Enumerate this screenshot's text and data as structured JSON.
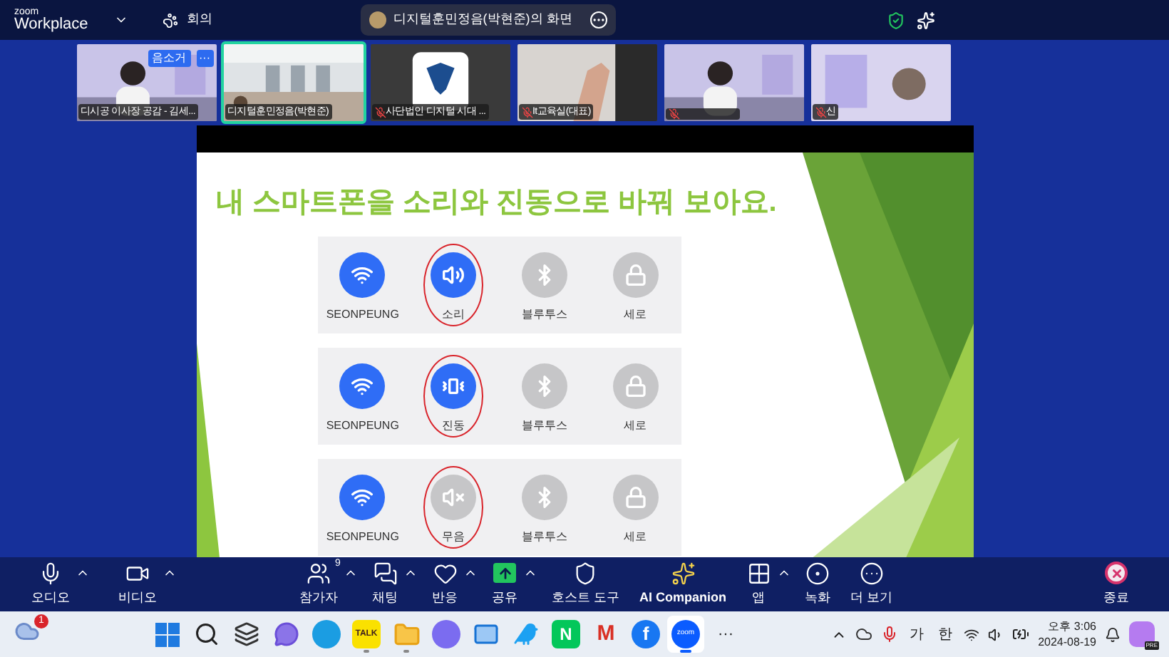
{
  "app": {
    "brand_top": "zoom",
    "brand_bottom": "Workplace",
    "meeting_label": "회의"
  },
  "share_title": "디지털훈민정음(박현준)의 화면",
  "participants": [
    {
      "name": "디시공 이사장 공감 - 김세...",
      "muted": false,
      "speaking": false,
      "mute_button": "음소거",
      "menu": "···",
      "kind": "person"
    },
    {
      "name": "디지털훈민정음(박현준)",
      "muted": false,
      "speaking": true,
      "kind": "room"
    },
    {
      "name": "사단법인 디지털 시대 ...",
      "muted": true,
      "speaking": false,
      "kind": "logo"
    },
    {
      "name": "It교육실(대표)",
      "muted": true,
      "speaking": false,
      "kind": "hand"
    },
    {
      "muted": true,
      "speaking": false,
      "kind": "person"
    },
    {
      "name": "신",
      "muted": true,
      "speaking": false,
      "kind": "slide"
    }
  ],
  "slide": {
    "title": "내 스마트폰을 소리와 진동으로 바꿔 보아요.",
    "rows": [
      {
        "items": [
          {
            "kind": "wifi",
            "label": "SEONPEUNG",
            "on": true,
            "circled": false
          },
          {
            "kind": "sound",
            "label": "소리",
            "on": true,
            "circled": true
          },
          {
            "kind": "bluetooth",
            "label": "블루투스",
            "on": false,
            "circled": false
          },
          {
            "kind": "rotation",
            "label": "세로",
            "on": false,
            "circled": false
          }
        ]
      },
      {
        "items": [
          {
            "kind": "wifi",
            "label": "SEONPEUNG",
            "on": true,
            "circled": false
          },
          {
            "kind": "vibrate",
            "label": "진동",
            "on": true,
            "circled": true
          },
          {
            "kind": "bluetooth",
            "label": "블루투스",
            "on": false,
            "circled": false
          },
          {
            "kind": "rotation",
            "label": "세로",
            "on": false,
            "circled": false
          }
        ]
      },
      {
        "items": [
          {
            "kind": "wifi",
            "label": "SEONPEUNG",
            "on": true,
            "circled": false
          },
          {
            "kind": "mute",
            "label": "무음",
            "on": false,
            "circled": true
          },
          {
            "kind": "bluetooth",
            "label": "블루투스",
            "on": false,
            "circled": false
          },
          {
            "kind": "rotation",
            "label": "세로",
            "on": false,
            "circled": false
          }
        ]
      }
    ]
  },
  "toolbar": [
    {
      "kind": "audio",
      "label": "오디오",
      "caret": true
    },
    {
      "kind": "video",
      "label": "비디오",
      "caret": true
    },
    {
      "kind": "participants",
      "label": "참가자",
      "count": "9",
      "caret": true
    },
    {
      "kind": "chat",
      "label": "채팅",
      "caret": true
    },
    {
      "kind": "react",
      "label": "반응",
      "caret": true
    },
    {
      "kind": "share",
      "label": "공유",
      "caret": true
    },
    {
      "kind": "host",
      "label": "호스트 도구",
      "caret": false
    },
    {
      "kind": "ai",
      "label": "AI Companion",
      "caret": false
    },
    {
      "kind": "apps",
      "label": "앱",
      "caret": true
    },
    {
      "kind": "record",
      "label": "녹화",
      "caret": false
    },
    {
      "kind": "more",
      "label": "더 보기",
      "caret": false
    },
    {
      "kind": "end",
      "label": "종료",
      "caret": false
    }
  ],
  "taskbar": {
    "widget_badge": "1",
    "apps": [
      {
        "kind": "start",
        "running": false,
        "active": false
      },
      {
        "kind": "search",
        "running": false,
        "active": false
      },
      {
        "kind": "taskview",
        "running": false,
        "active": false
      },
      {
        "kind": "chat",
        "running": false,
        "active": false
      },
      {
        "kind": "edge",
        "running": false,
        "active": false
      },
      {
        "kind": "kakao",
        "label": "TALK",
        "running": true,
        "active": false
      },
      {
        "kind": "files",
        "running": true,
        "active": false
      },
      {
        "kind": "office",
        "running": false,
        "active": false
      },
      {
        "kind": "mail",
        "running": false,
        "active": false
      },
      {
        "kind": "bird",
        "running": false,
        "active": false
      },
      {
        "kind": "naver",
        "label": "N",
        "running": false,
        "active": false
      },
      {
        "kind": "gmail",
        "label": "M",
        "running": false,
        "active": false
      },
      {
        "kind": "facebook",
        "label": "f",
        "running": false,
        "active": false
      },
      {
        "kind": "zoom",
        "label": "zoom",
        "running": true,
        "active": true
      },
      {
        "kind": "more",
        "label": "···",
        "running": false,
        "active": false
      }
    ],
    "ime": [
      "가",
      "한"
    ],
    "time": "오후 3:06",
    "date": "2024-08-19",
    "copilot_badge": "PRE"
  }
}
